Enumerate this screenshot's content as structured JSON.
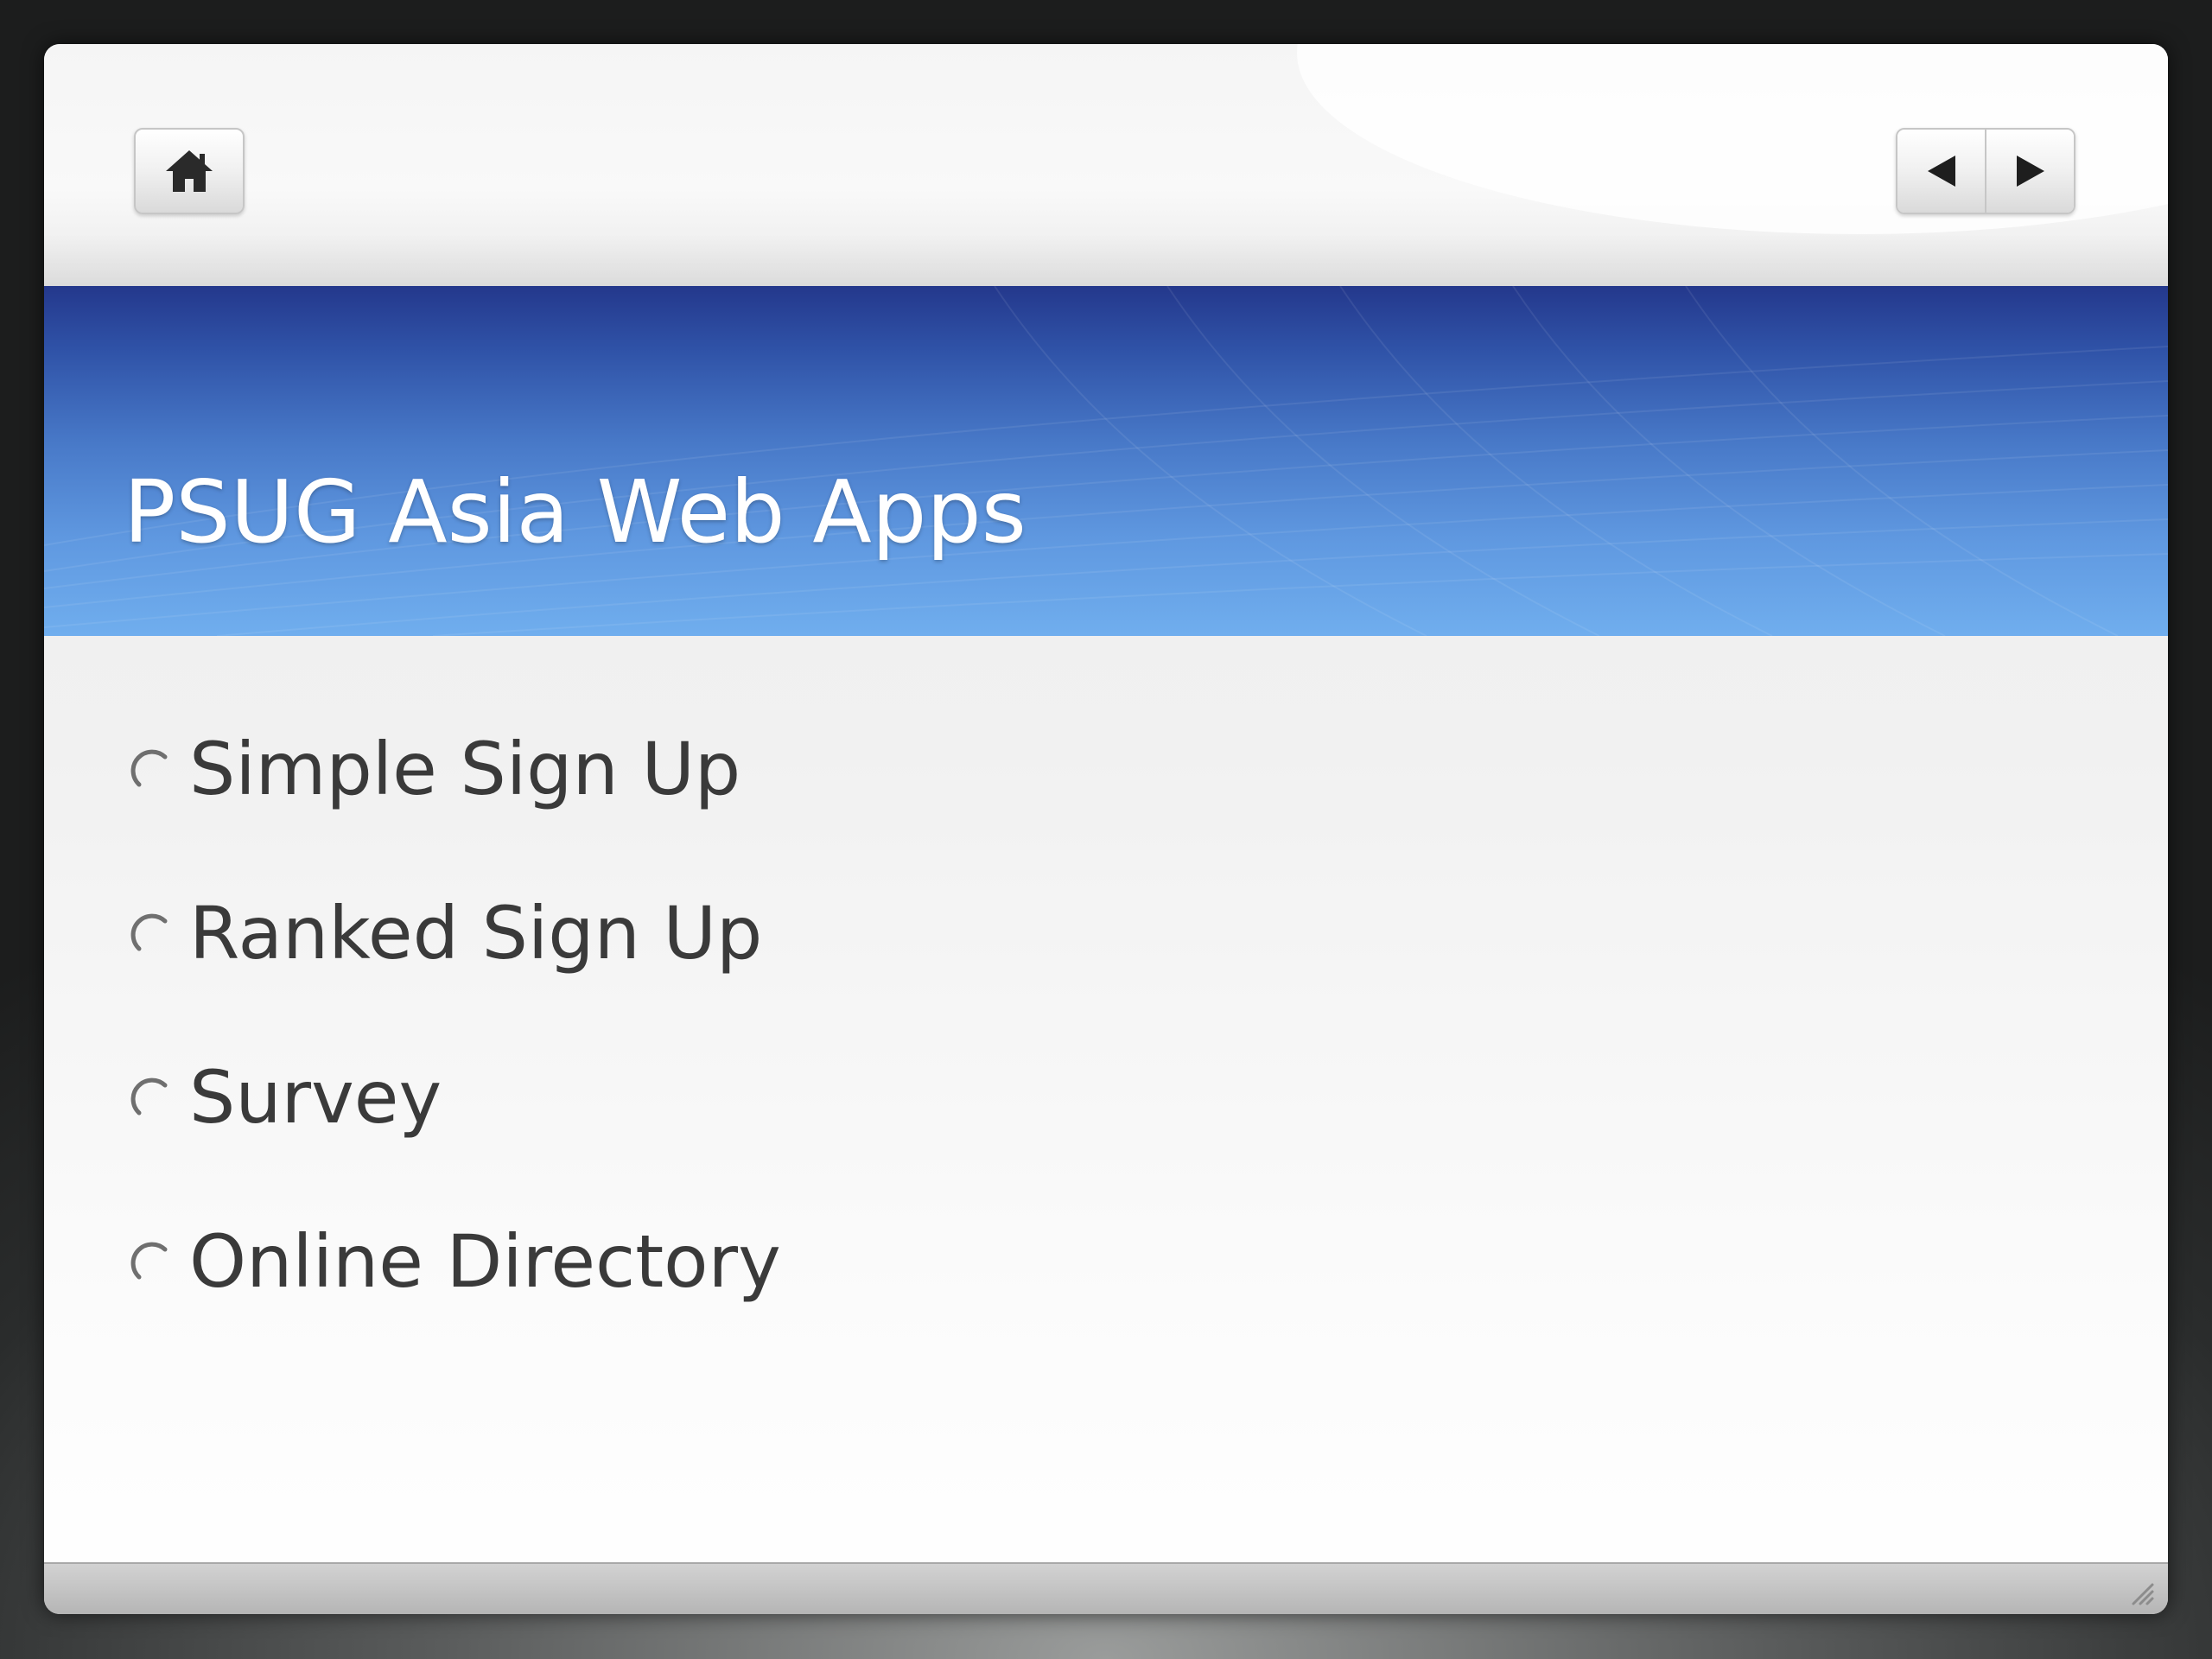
{
  "toolbar": {
    "home_icon": "home-icon",
    "prev_icon": "triangle-left-icon",
    "next_icon": "triangle-right-icon"
  },
  "slide": {
    "title": "PSUG Asia Web Apps",
    "bullet_icon": "partial-circle-bullet-icon",
    "bullets": [
      "Simple Sign Up",
      "Ranked Sign Up",
      "Survey",
      "Online Directory"
    ]
  },
  "colors": {
    "title_band_top": "#24388c",
    "title_band_bottom": "#70aeee",
    "title_text": "#ffffff",
    "body_text": "#3a3a3a",
    "backdrop": "#1c1d1d"
  }
}
